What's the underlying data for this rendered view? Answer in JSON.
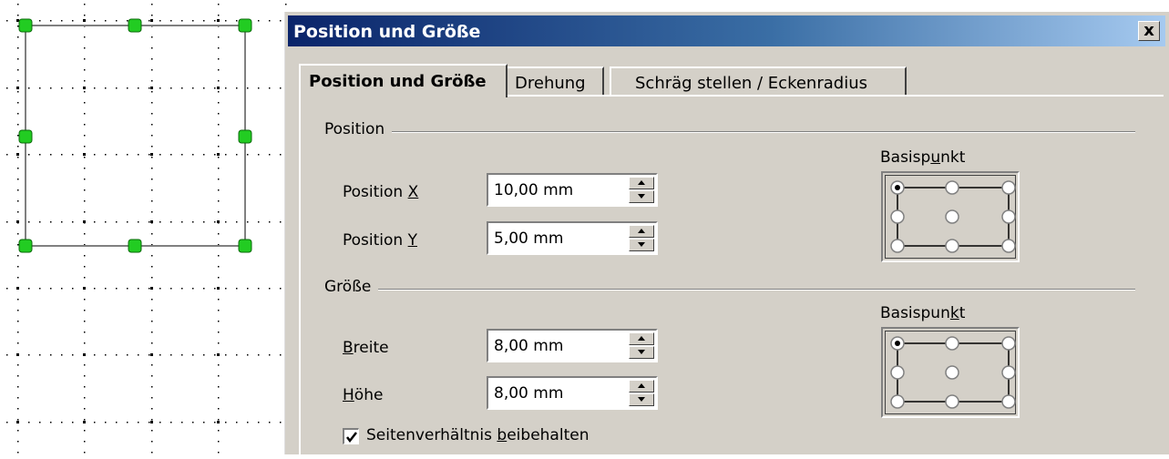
{
  "dialog": {
    "title": "Position und Größe",
    "close_glyph": "x",
    "tabs": [
      {
        "label": "Position und Größe",
        "active": true
      },
      {
        "label": "Drehung",
        "active": false
      },
      {
        "label": "Schräg stellen / Eckenradius",
        "active": false
      }
    ],
    "position_group": {
      "label": "Position",
      "x_label_pre": "Position ",
      "x_label_key": "X",
      "x_value": "10,00 mm",
      "y_label_pre": "Position ",
      "y_label_key": "Y",
      "y_value": "5,00 mm",
      "basis_label_pre": "Basisp",
      "basis_label_key": "u",
      "basis_label_post": "nkt",
      "basis_selected": "top-left"
    },
    "size_group": {
      "label": "Größe",
      "width_label_key": "B",
      "width_label_post": "reite",
      "width_value": "8,00 mm",
      "height_label_key": "H",
      "height_label_post": "öhe",
      "height_value": "8,00 mm",
      "basis_label_pre": "Basispun",
      "basis_label_key": "k",
      "basis_label_post": "t",
      "basis_selected": "top-left",
      "keep_ratio_pre": "Seitenverhältnis ",
      "keep_ratio_key": "b",
      "keep_ratio_post": "eibehalten",
      "keep_ratio_checked": true
    }
  },
  "canvas": {
    "handle_color": "#22cc22",
    "frame_color": "#808080"
  }
}
